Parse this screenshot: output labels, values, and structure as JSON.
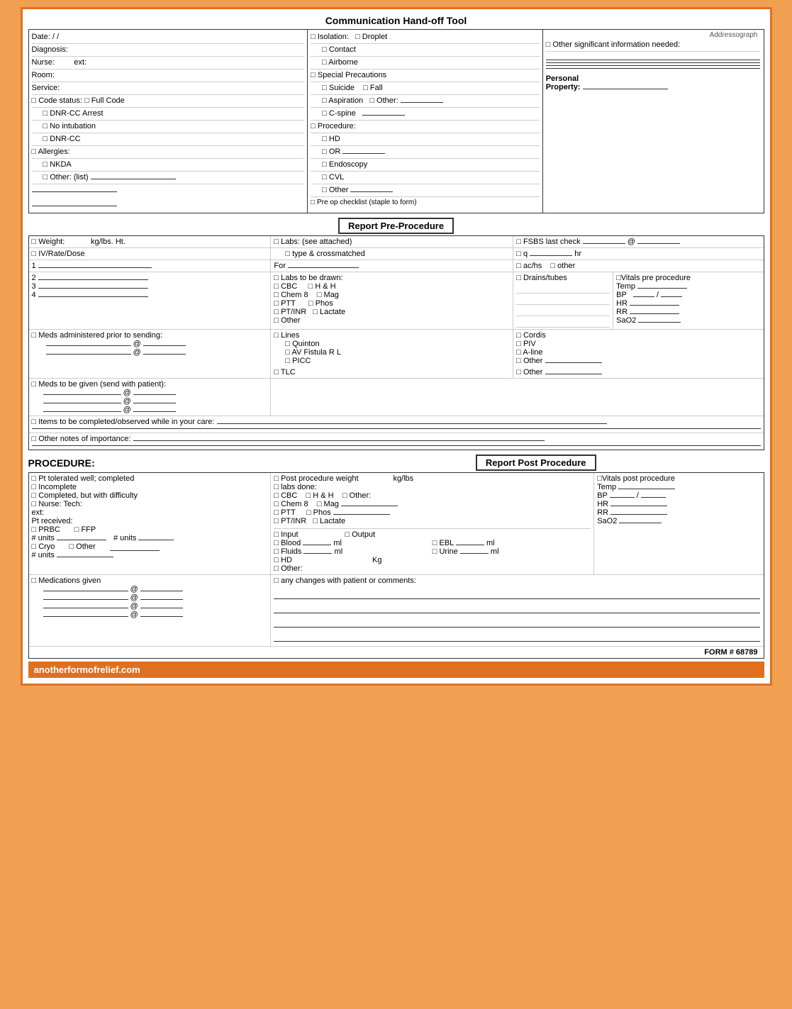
{
  "title": "Communication Hand-off Tool",
  "top": {
    "left": {
      "date_label": "Date:",
      "date_slash1": "/",
      "date_slash2": "/",
      "diagnosis_label": "Diagnosis:",
      "nurse_label": "Nurse:",
      "ext_label": "ext:",
      "room_label": "Room:",
      "service_label": "Service:",
      "code_status": "□ Code status: □ Full Code",
      "dnr_cc_arrest": "□ DNR-CC Arrest",
      "no_intubation": "□ No intubation",
      "dnr_cc": "□ DNR-CC",
      "allergies": "□ Allergies:",
      "nkda": "□ NKDA",
      "other_list": "□ Other: (list)"
    },
    "middle": {
      "isolation_label": "□ Isolation:",
      "droplet": "□ Droplet",
      "contact": "□ Contact",
      "airborne": "□ Airborne",
      "special_precautions": "□ Special Precautions",
      "suicide": "□ Suicide",
      "fall": "□ Fall",
      "aspiration": "□ Aspiration",
      "other": "□ Other:",
      "c_spine": "□ C-spine",
      "procedure_label": "□ Procedure:",
      "hd": "□ HD",
      "or": "□ OR",
      "endoscopy": "□ Endoscopy",
      "cvl": "□ CVL",
      "other_proc": "□ Other",
      "pre_op": "□ Pre op checklist (staple to form)"
    },
    "right": {
      "addressograph": "Addressograph",
      "other_sig": "□ Other significant information needed:",
      "personal_property": "Personal",
      "property": "Property:"
    }
  },
  "pre_procedure": {
    "header": "Report Pre-Procedure",
    "weight_label": "□ Weight:",
    "weight_unit": "kg/lbs.  Ht.",
    "iv_label": "□ IV/Rate/Dose",
    "lines_1": "1",
    "lines_2": "2",
    "lines_3": "3",
    "lines_4": "4",
    "meds_prior": "□ Meds administered prior to sending:",
    "at1": "@",
    "at2": "@",
    "meds_send": "□ Meds to be given (send with patient):",
    "at3": "@",
    "at4": "@",
    "at5": "@",
    "labs_label": "□ Labs: (see attached)",
    "type_cross": "□ type & crossmatched",
    "for_label": "For",
    "labs_drawn": "□ Labs to be drawn:",
    "cbc": "□ CBC",
    "hh": "□ H & H",
    "chem8": "□ Chem 8",
    "mag": "□ Mag",
    "ptt": "□ PTT",
    "phos": "□ Phos",
    "ptinr": "□ PT/INR",
    "lactate": "□ Lactate",
    "other_labs": "□ Other",
    "drains_tubes": "□ Drains/tubes",
    "lines_section": "□ Lines",
    "quinton": "□ Quinton",
    "av_fistula": "□ AV Fistula  R   L",
    "picc": "□ PICC",
    "tlc": "□ TLC",
    "cordis": "□ Cordis",
    "piv": "□ PIV",
    "a_line": "□ A-line",
    "other_lines": "□ Other",
    "other_lines2": "□ Other",
    "fsbs_label": "□ FSBS last check",
    "at_symbol": "@",
    "q_label": "□ q",
    "hr_label": "hr",
    "achs": "□ ac/hs",
    "other_fsbs": "□ other",
    "vitals_pre": "□Vitals pre procedure",
    "temp": "Temp",
    "bp": "BP",
    "bp_slash": "/",
    "hr": "HR",
    "rr": "RR",
    "sao2": "SaO2",
    "items_label": "□ Items to be completed/observed while in your care:",
    "other_notes": "□ Other notes of importance:"
  },
  "post_procedure": {
    "left_header": "PROCEDURE:",
    "right_header": "Report Post Procedure",
    "pt_tolerated": "□ Pt tolerated well; completed",
    "incomplete": "□ Incomplete",
    "completed_diff": "□ Completed, but with difficulty",
    "nurse_tech": "□ Nurse: Tech:",
    "ext": "ext:",
    "pt_received": "Pt received:",
    "prbc": "□ PRBC",
    "ffp": "□ FFP",
    "units_prbc": "# units",
    "units_ffp": "# units",
    "cryo": "□ Cryo",
    "other_blood": "□ Other",
    "units_cryo": "# units",
    "post_weight": "□ Post procedure weight",
    "kg_lbs": "kg/lbs",
    "labs_done": "□ labs done:",
    "cbc": "□ CBC",
    "hh": "□ H & H",
    "other_post": "□ Other:",
    "chem8": "□ Chem 8",
    "mag": "□ Mag",
    "ptt": "□ PTT",
    "phos": "□ Phos",
    "ptinr": "□ PT/INR",
    "lactate": "□ Lactate",
    "input": "□ Input",
    "blood": "□ Blood",
    "blood_ml": "ml",
    "fluids": "□ Fluids",
    "fluids_ml": "ml",
    "output": "□ Output",
    "ebl": "□ EBL",
    "ebl_ml": "ml",
    "urine": "□ Urine",
    "urine_ml": "ml",
    "hd": "□ HD",
    "hd_kg": "Kg",
    "other_output": "□ Other:",
    "vitals_post": "□Vitals post procedure",
    "temp": "Temp",
    "bp": "BP",
    "bp_slash": "/",
    "hr": "HR",
    "rr": "RR",
    "sao2": "SaO2",
    "meds_given": "□ Medications given",
    "at1": "@",
    "at2": "@",
    "at3": "@",
    "at4": "@",
    "any_changes": "□ any changes with patient or comments:",
    "form_number": "FORM # 68789"
  },
  "footer": {
    "website": "anotherformofrelief.com"
  }
}
